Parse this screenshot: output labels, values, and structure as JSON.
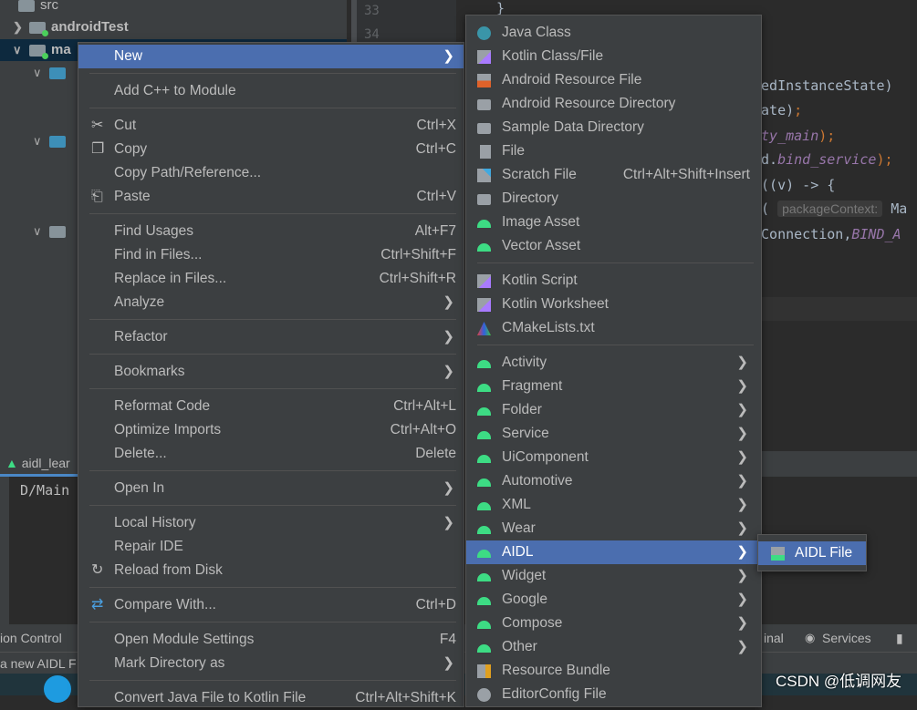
{
  "project_tree": {
    "items": [
      {
        "label": "src",
        "bold": false
      },
      {
        "label": "androidTest",
        "bold": true
      },
      {
        "label": "ma",
        "bold": true
      }
    ]
  },
  "editor": {
    "line_numbers": [
      "33",
      "34"
    ],
    "code_lines": [
      {
        "pre": "}",
        "it": "",
        "post": ""
      },
      {
        "pre": "vedInstanceState)",
        "it": "",
        "post": ""
      },
      {
        "pre": "tate)",
        "it": "",
        "post": ";"
      },
      {
        "pre": "",
        "it": "ity_main",
        "post": ");"
      },
      {
        "pre": "id.",
        "it": "bind_service",
        "post": ");"
      },
      {
        "pre": "r((v) -> {",
        "it": "",
        "post": ""
      },
      {
        "pre": "t(",
        "hint": "packageContext:",
        "post2": "Ma"
      },
      {
        "pre": "eConnection,",
        "it": "BIND_A",
        "post": ""
      }
    ]
  },
  "tool_window": {
    "tab_label": "aidl_lear",
    "console_text": "D/Main"
  },
  "status_bar": {
    "left": "ion Control",
    "terminal": "inal",
    "services": "Services",
    "message": "a new AIDL F"
  },
  "watermark": "CSDN @低调网友",
  "context_menu": {
    "items": [
      {
        "type": "item",
        "label": "New",
        "submenu": true,
        "highlighted": true
      },
      {
        "type": "sep"
      },
      {
        "type": "item",
        "label": "Add C++ to Module"
      },
      {
        "type": "sep"
      },
      {
        "type": "item",
        "label": "Cut",
        "shortcut": "Ctrl+X",
        "icon": "scissors-icon"
      },
      {
        "type": "item",
        "label": "Copy",
        "shortcut": "Ctrl+C",
        "icon": "copy-icon"
      },
      {
        "type": "item",
        "label": "Copy Path/Reference..."
      },
      {
        "type": "item",
        "label": "Paste",
        "shortcut": "Ctrl+V",
        "icon": "paste-icon"
      },
      {
        "type": "sep"
      },
      {
        "type": "item",
        "label": "Find Usages",
        "shortcut": "Alt+F7"
      },
      {
        "type": "item",
        "label": "Find in Files...",
        "shortcut": "Ctrl+Shift+F"
      },
      {
        "type": "item",
        "label": "Replace in Files...",
        "shortcut": "Ctrl+Shift+R"
      },
      {
        "type": "item",
        "label": "Analyze",
        "submenu": true
      },
      {
        "type": "sep"
      },
      {
        "type": "item",
        "label": "Refactor",
        "submenu": true
      },
      {
        "type": "sep"
      },
      {
        "type": "item",
        "label": "Bookmarks",
        "submenu": true
      },
      {
        "type": "sep"
      },
      {
        "type": "item",
        "label": "Reformat Code",
        "shortcut": "Ctrl+Alt+L"
      },
      {
        "type": "item",
        "label": "Optimize Imports",
        "shortcut": "Ctrl+Alt+O"
      },
      {
        "type": "item",
        "label": "Delete...",
        "shortcut": "Delete"
      },
      {
        "type": "sep"
      },
      {
        "type": "item",
        "label": "Open In",
        "submenu": true
      },
      {
        "type": "sep"
      },
      {
        "type": "item",
        "label": "Local History",
        "submenu": true
      },
      {
        "type": "item",
        "label": "Repair IDE"
      },
      {
        "type": "item",
        "label": "Reload from Disk",
        "icon": "reload-icon"
      },
      {
        "type": "sep"
      },
      {
        "type": "item",
        "label": "Compare With...",
        "shortcut": "Ctrl+D",
        "icon": "compare-icon"
      },
      {
        "type": "sep"
      },
      {
        "type": "item",
        "label": "Open Module Settings",
        "shortcut": "F4"
      },
      {
        "type": "item",
        "label": "Mark Directory as",
        "submenu": true
      },
      {
        "type": "sep"
      },
      {
        "type": "item",
        "label": "Convert Java File to Kotlin File",
        "shortcut": "Ctrl+Alt+Shift+K"
      }
    ]
  },
  "new_submenu": {
    "items": [
      {
        "type": "item",
        "label": "Java Class",
        "icon": "java-class-icon"
      },
      {
        "type": "item",
        "label": "Kotlin Class/File",
        "icon": "kotlin-file-icon"
      },
      {
        "type": "item",
        "label": "Android Resource File",
        "icon": "resource-file-icon"
      },
      {
        "type": "item",
        "label": "Android Resource Directory",
        "icon": "folder-icon"
      },
      {
        "type": "item",
        "label": "Sample Data Directory",
        "icon": "folder-icon"
      },
      {
        "type": "item",
        "label": "File",
        "icon": "file-icon"
      },
      {
        "type": "item",
        "label": "Scratch File",
        "shortcut": "Ctrl+Alt+Shift+Insert",
        "icon": "scratch-file-icon"
      },
      {
        "type": "item",
        "label": "Directory",
        "icon": "folder-icon"
      },
      {
        "type": "item",
        "label": "Image Asset",
        "icon": "android-icon"
      },
      {
        "type": "item",
        "label": "Vector Asset",
        "icon": "android-icon"
      },
      {
        "type": "sep"
      },
      {
        "type": "item",
        "label": "Kotlin Script",
        "icon": "kotlin-file-icon"
      },
      {
        "type": "item",
        "label": "Kotlin Worksheet",
        "icon": "kotlin-file-icon"
      },
      {
        "type": "item",
        "label": "CMakeLists.txt",
        "icon": "cmake-icon"
      },
      {
        "type": "sep"
      },
      {
        "type": "item",
        "label": "Activity",
        "icon": "android-icon",
        "submenu": true
      },
      {
        "type": "item",
        "label": "Fragment",
        "icon": "android-icon",
        "submenu": true
      },
      {
        "type": "item",
        "label": "Folder",
        "icon": "android-icon",
        "submenu": true
      },
      {
        "type": "item",
        "label": "Service",
        "icon": "android-icon",
        "submenu": true
      },
      {
        "type": "item",
        "label": "UiComponent",
        "icon": "android-icon",
        "submenu": true
      },
      {
        "type": "item",
        "label": "Automotive",
        "icon": "android-icon",
        "submenu": true
      },
      {
        "type": "item",
        "label": "XML",
        "icon": "android-icon",
        "submenu": true
      },
      {
        "type": "item",
        "label": "Wear",
        "icon": "android-icon",
        "submenu": true
      },
      {
        "type": "item",
        "label": "AIDL",
        "icon": "android-icon",
        "submenu": true,
        "highlighted": true
      },
      {
        "type": "item",
        "label": "Widget",
        "icon": "android-icon",
        "submenu": true
      },
      {
        "type": "item",
        "label": "Google",
        "icon": "android-icon",
        "submenu": true
      },
      {
        "type": "item",
        "label": "Compose",
        "icon": "android-icon",
        "submenu": true
      },
      {
        "type": "item",
        "label": "Other",
        "icon": "android-icon",
        "submenu": true
      },
      {
        "type": "item",
        "label": "Resource Bundle",
        "icon": "resource-bundle-icon"
      },
      {
        "type": "item",
        "label": "EditorConfig File",
        "icon": "gear-file-icon"
      }
    ]
  },
  "aidl_submenu": {
    "items": [
      {
        "type": "item",
        "label": "AIDL File",
        "icon": "aidl-file-icon",
        "highlighted": true
      }
    ]
  },
  "colors": {
    "highlight": "#4b6eaf",
    "menu_bg": "#3c3f41",
    "android_green": "#3ddc84"
  }
}
